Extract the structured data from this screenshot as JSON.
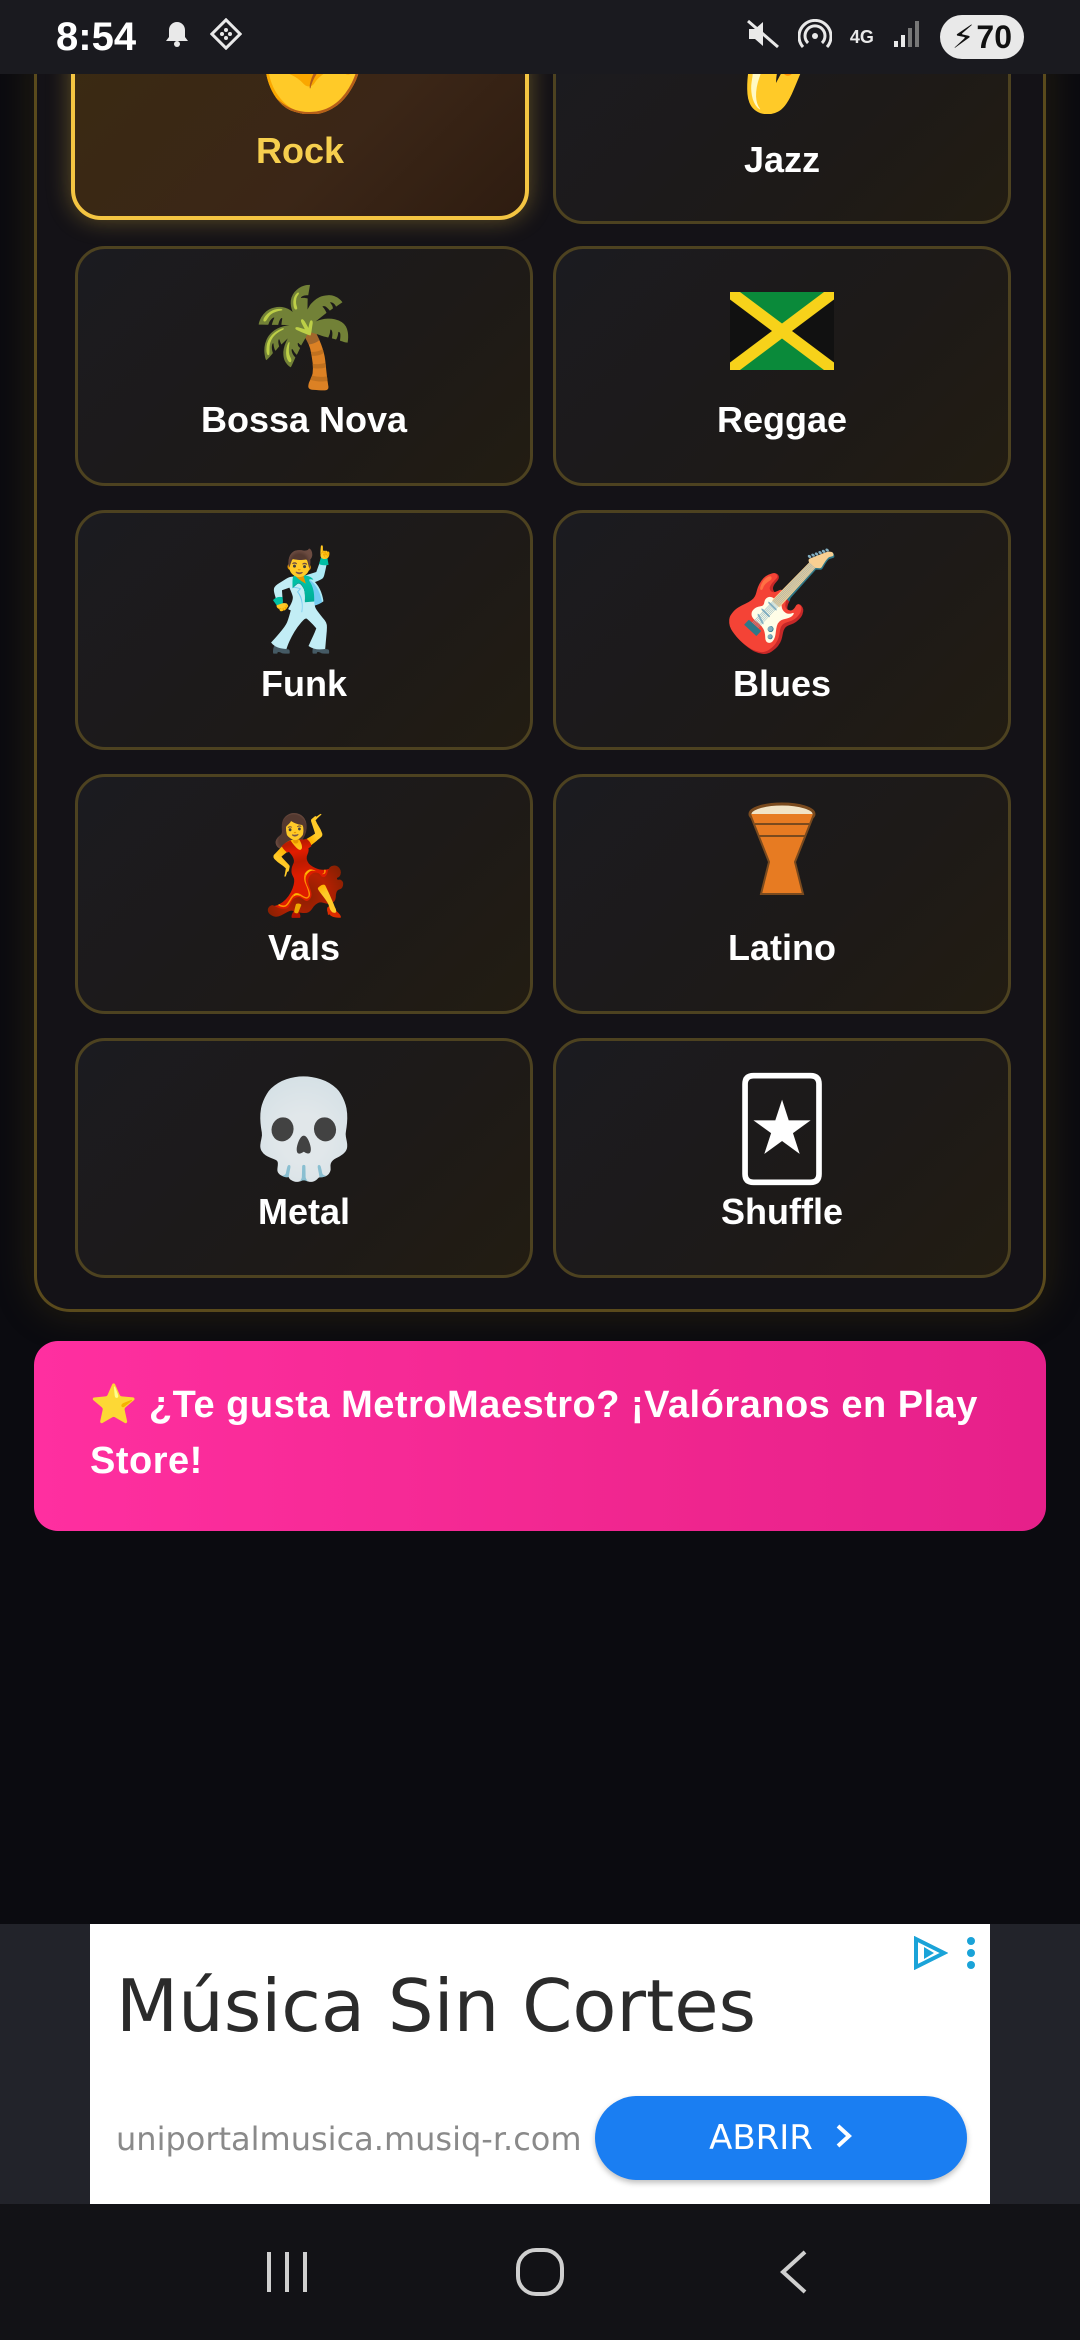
{
  "status_bar": {
    "time": "8:54",
    "network": "4G",
    "battery": "70",
    "icons": [
      "bell-icon",
      "app-grid-icon",
      "mute-icon",
      "hotspot-icon",
      "signal-icon",
      "battery-charging-icon"
    ]
  },
  "genres": [
    {
      "label": "Rock",
      "icon": "fist-icon",
      "emoji": "✊",
      "selected": true
    },
    {
      "label": "Jazz",
      "icon": "saxophone-icon",
      "emoji": "🎷",
      "selected": false
    },
    {
      "label": "Bossa Nova",
      "icon": "palm-tree-icon",
      "emoji": "🌴",
      "selected": false
    },
    {
      "label": "Reggae",
      "icon": "jamaica-flag-icon",
      "emoji": "🇯🇲",
      "selected": false
    },
    {
      "label": "Funk",
      "icon": "disco-dancer-icon",
      "emoji": "🕺",
      "selected": false
    },
    {
      "label": "Blues",
      "icon": "guitar-icon",
      "emoji": "🎸",
      "selected": false
    },
    {
      "label": "Vals",
      "icon": "woman-dancing-icon",
      "emoji": "💃",
      "selected": false
    },
    {
      "label": "Latino",
      "icon": "drum-icon",
      "emoji": "🪘",
      "selected": false
    },
    {
      "label": "Metal",
      "icon": "skull-icon",
      "emoji": "💀",
      "selected": false
    },
    {
      "label": "Shuffle",
      "icon": "joker-card-icon",
      "emoji": "🃏",
      "selected": false
    }
  ],
  "rating_banner": {
    "star": "⭐",
    "text": "¿Te gusta MetroMaestro? ¡Valóranos en Play Store!"
  },
  "ad": {
    "title": "Música Sin Cortes",
    "url": "uniportalmusica.musiq-r.com",
    "cta": "ABRIR"
  },
  "colors": {
    "accent_gold": "#f4c542",
    "banner_pink": "#f0268f",
    "ad_button_blue": "#1a7ef2",
    "background": "#0b0b10"
  }
}
